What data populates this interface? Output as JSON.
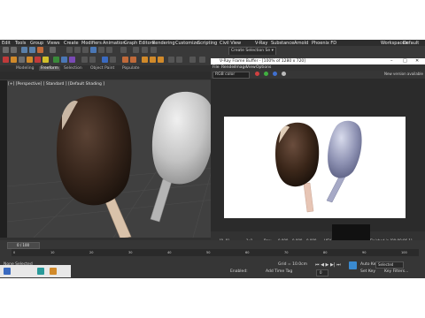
{
  "menubar": [
    "Edit",
    "Tools",
    "Group",
    "Views",
    "Create",
    "Modifiers",
    "Animation",
    "Graph Editors",
    "Rendering",
    "Customize",
    "Scripting",
    "Civil View",
    "V-Ray",
    "Substance",
    "Arnold",
    "Phoenix FD"
  ],
  "workspace_label": "Workspaces:",
  "workspace_value": "Default",
  "selection_set": "Create Selection Se ▾",
  "ribbon_tabs": [
    "Modeling",
    "Freeform",
    "Selection",
    "Object Paint",
    "Populate"
  ],
  "viewport_label": "[+] [Perspective] [ Standard ] [Default Shading ]",
  "vfb": {
    "title": "V-Ray Frame Buffer - [100% of 1280 x 720]",
    "menus": [
      "File",
      "Render",
      "Image",
      "View",
      "Options"
    ],
    "channel": "RGB color",
    "notice": "New version available",
    "coords": "[0, 0]",
    "status_fields": [
      "1x1",
      "Raw",
      "0.000",
      "0.000",
      "0.000"
    ],
    "mode": "HSV",
    "finished": "Finished in [00:00:06.1]"
  },
  "timeline": {
    "frame_counter": "0 / 100",
    "ticks": [
      "0",
      "10",
      "20",
      "30",
      "40",
      "50",
      "60",
      "70",
      "80",
      "90",
      "100"
    ]
  },
  "status": {
    "selection": "None Selected",
    "grid": "Grid = 10.0cm",
    "autokey": "Auto Key",
    "set_key": "Set Key",
    "selected": "Selected",
    "key_filters": "Key Filters...",
    "enabled": "Enabled:",
    "add_time_tag": "Add Time Tag",
    "frame": "0"
  },
  "colors": {
    "chocolate": "#3d2a20",
    "white_bar": "#c9c9c9",
    "stick": "#e0c4a8",
    "render_blue": "#8c90b0"
  }
}
